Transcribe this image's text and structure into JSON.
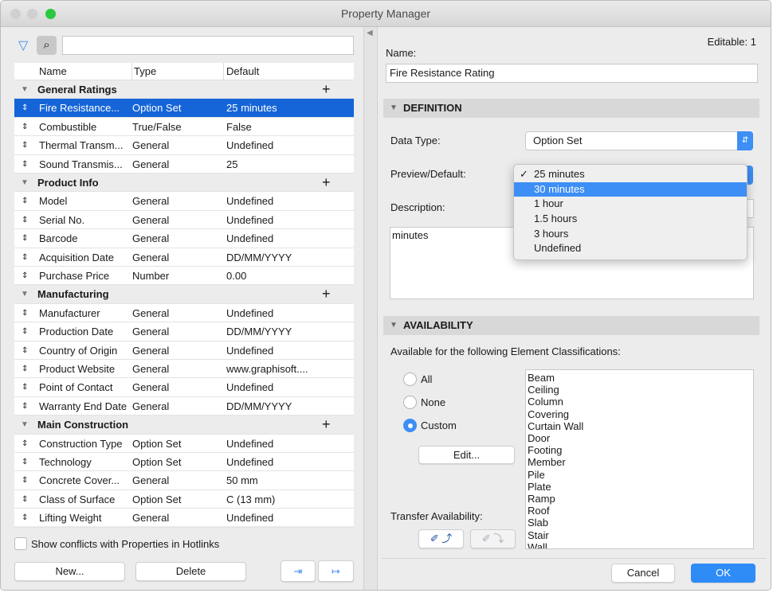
{
  "window": {
    "title": "Property Manager"
  },
  "left": {
    "columns": {
      "name": "Name",
      "type": "Type",
      "default": "Default"
    },
    "groups": [
      {
        "label": "General Ratings",
        "rows": [
          {
            "name": "Fire Resistance...",
            "type": "Option Set",
            "default": "25 minutes",
            "selected": true
          },
          {
            "name": "Combustible",
            "type": "True/False",
            "default": "False"
          },
          {
            "name": "Thermal Transm...",
            "type": "General",
            "default": "Undefined"
          },
          {
            "name": "Sound Transmis...",
            "type": "General",
            "default": "25"
          }
        ]
      },
      {
        "label": "Product Info",
        "rows": [
          {
            "name": "Model",
            "type": "General",
            "default": "Undefined"
          },
          {
            "name": "Serial No.",
            "type": "General",
            "default": "Undefined"
          },
          {
            "name": "Barcode",
            "type": "General",
            "default": "Undefined"
          },
          {
            "name": "Acquisition Date",
            "type": "General",
            "default": "DD/MM/YYYY"
          },
          {
            "name": "Purchase Price",
            "type": "Number",
            "default": "0.00"
          }
        ]
      },
      {
        "label": "Manufacturing",
        "rows": [
          {
            "name": "Manufacturer",
            "type": "General",
            "default": "Undefined"
          },
          {
            "name": "Production Date",
            "type": "General",
            "default": "DD/MM/YYYY"
          },
          {
            "name": "Country of Origin",
            "type": "General",
            "default": "Undefined"
          },
          {
            "name": "Product Website",
            "type": "General",
            "default": "www.graphisoft...."
          },
          {
            "name": "Point of Contact",
            "type": "General",
            "default": "Undefined"
          },
          {
            "name": "Warranty End Date",
            "type": "General",
            "default": "DD/MM/YYYY"
          }
        ]
      },
      {
        "label": "Main Construction",
        "rows": [
          {
            "name": "Construction Type",
            "type": "Option Set",
            "default": "Undefined"
          },
          {
            "name": "Technology",
            "type": "Option Set",
            "default": "Undefined"
          },
          {
            "name": "Concrete Cover...",
            "type": "General",
            "default": "50 mm"
          },
          {
            "name": "Class of Surface",
            "type": "Option Set",
            "default": "C (13 mm)"
          },
          {
            "name": "Lifting Weight",
            "type": "General",
            "default": "Undefined"
          }
        ]
      }
    ],
    "show_conflicts_label": "Show conflicts with Properties in Hotlinks",
    "show_conflicts_checked": false,
    "new_label": "New...",
    "delete_label": "Delete"
  },
  "right": {
    "editable": "Editable: 1",
    "name_label": "Name:",
    "name_value": "Fire Resistance Rating",
    "definition": "DEFINITION",
    "data_type_label": "Data Type:",
    "data_type_value": "Option Set",
    "preview_label": "Preview/Default:",
    "preview_options": [
      "25 minutes",
      "30 minutes",
      "1 hour",
      "1.5 hours",
      "3 hours",
      "Undefined"
    ],
    "preview_checked": "25 minutes",
    "preview_highlighted": "30 minutes",
    "description_label": "Description:",
    "description_value": "minutes",
    "availability": "AVAILABILITY",
    "available_label": "Available for the following Element Classifications:",
    "radios": [
      "All",
      "None",
      "Custom"
    ],
    "radio_selected": "Custom",
    "edit_label": "Edit...",
    "classifications": [
      "Beam",
      "Ceiling",
      "Column",
      "Covering",
      "Curtain Wall",
      "Door",
      "Footing",
      "Member",
      "Pile",
      "Plate",
      "Ramp",
      "Roof",
      "Slab",
      "Stair",
      "Wall"
    ],
    "transfer_label": "Transfer Availability:",
    "cancel_label": "Cancel",
    "ok_label": "OK"
  },
  "colors": {
    "selection": "#1565d8",
    "accent": "#3d8ef5",
    "ok": "#2f8cf6"
  }
}
